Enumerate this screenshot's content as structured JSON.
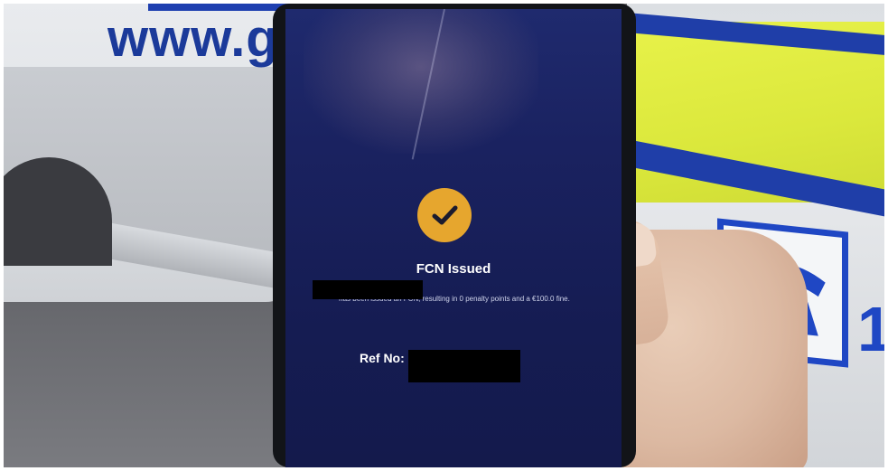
{
  "background": {
    "website_text": "www.gar",
    "plate_digit": "1",
    "colors": {
      "livery_blue": "#1f3ea8",
      "livery_yellow": "#dbe83c",
      "car_white": "#e6e8eb"
    },
    "phone_sign_icon": "telephone-icon"
  },
  "screen": {
    "status_icon": "checkmark-icon",
    "status_icon_color": "#e6a62e",
    "title": "FCN Issued",
    "message_visible": "has been issued an FCN, resulting in 0 penalty points and a €100.0 fine.",
    "ref_label": "Ref No:",
    "redacted_fields": [
      "recipient-name",
      "reference-number"
    ],
    "background_color": "#1a2260"
  }
}
